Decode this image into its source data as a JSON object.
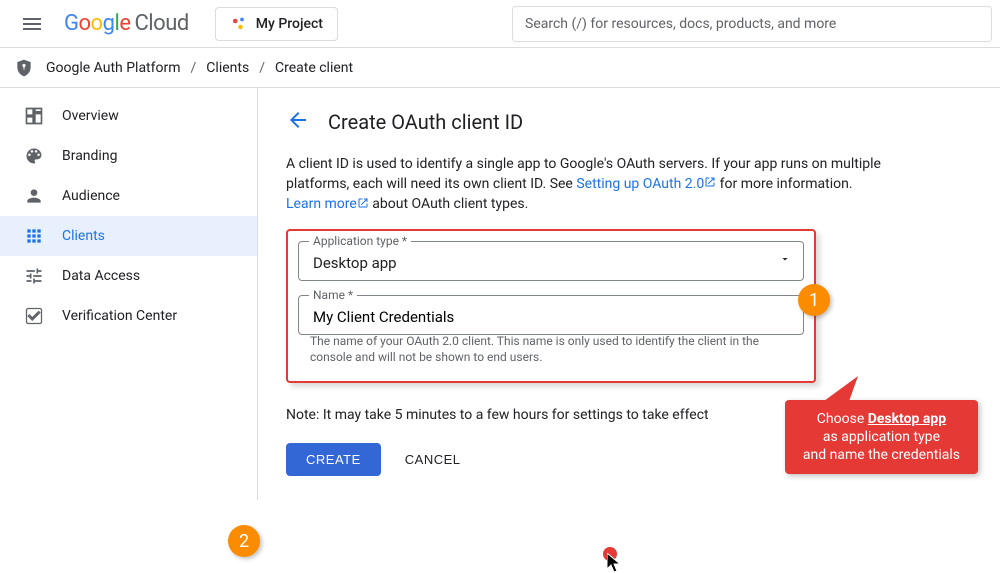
{
  "header": {
    "product_name": "Cloud",
    "project_button_label": "My Project",
    "search_placeholder": "Search (/) for resources, docs, products, and more"
  },
  "breadcrumb": {
    "platform": "Google Auth Platform",
    "clients": "Clients",
    "create": "Create client"
  },
  "sidebar": {
    "items": [
      {
        "label": "Overview"
      },
      {
        "label": "Branding"
      },
      {
        "label": "Audience"
      },
      {
        "label": "Clients"
      },
      {
        "label": "Data Access"
      },
      {
        "label": "Verification Center"
      }
    ]
  },
  "main": {
    "page_title": "Create OAuth client ID",
    "description_1": "A client ID is used to identify a single app to Google's OAuth servers. If your app runs on multiple platforms, each will need its own client ID. See ",
    "link_setup": "Setting up OAuth 2.0",
    "description_2": " for more information. ",
    "link_learn": "Learn more",
    "description_3": " about OAuth client types.",
    "form": {
      "app_type_label": "Application type *",
      "app_type_value": "Desktop app",
      "name_label": "Name *",
      "name_value": "My Client Credentials",
      "name_help": "The name of your OAuth 2.0 client. This name is only used to identify the client in the console and will not be shown to end users."
    },
    "note": "Note: It may take 5 minutes to a few hours for settings to take effect",
    "create_button": "CREATE",
    "cancel_button": "CANCEL"
  },
  "annotations": {
    "step_1": "1",
    "step_2": "2",
    "callout_line1": "Choose ",
    "callout_strong": "Desktop app",
    "callout_line2": "as application type",
    "callout_line3": "and name the credentials"
  }
}
